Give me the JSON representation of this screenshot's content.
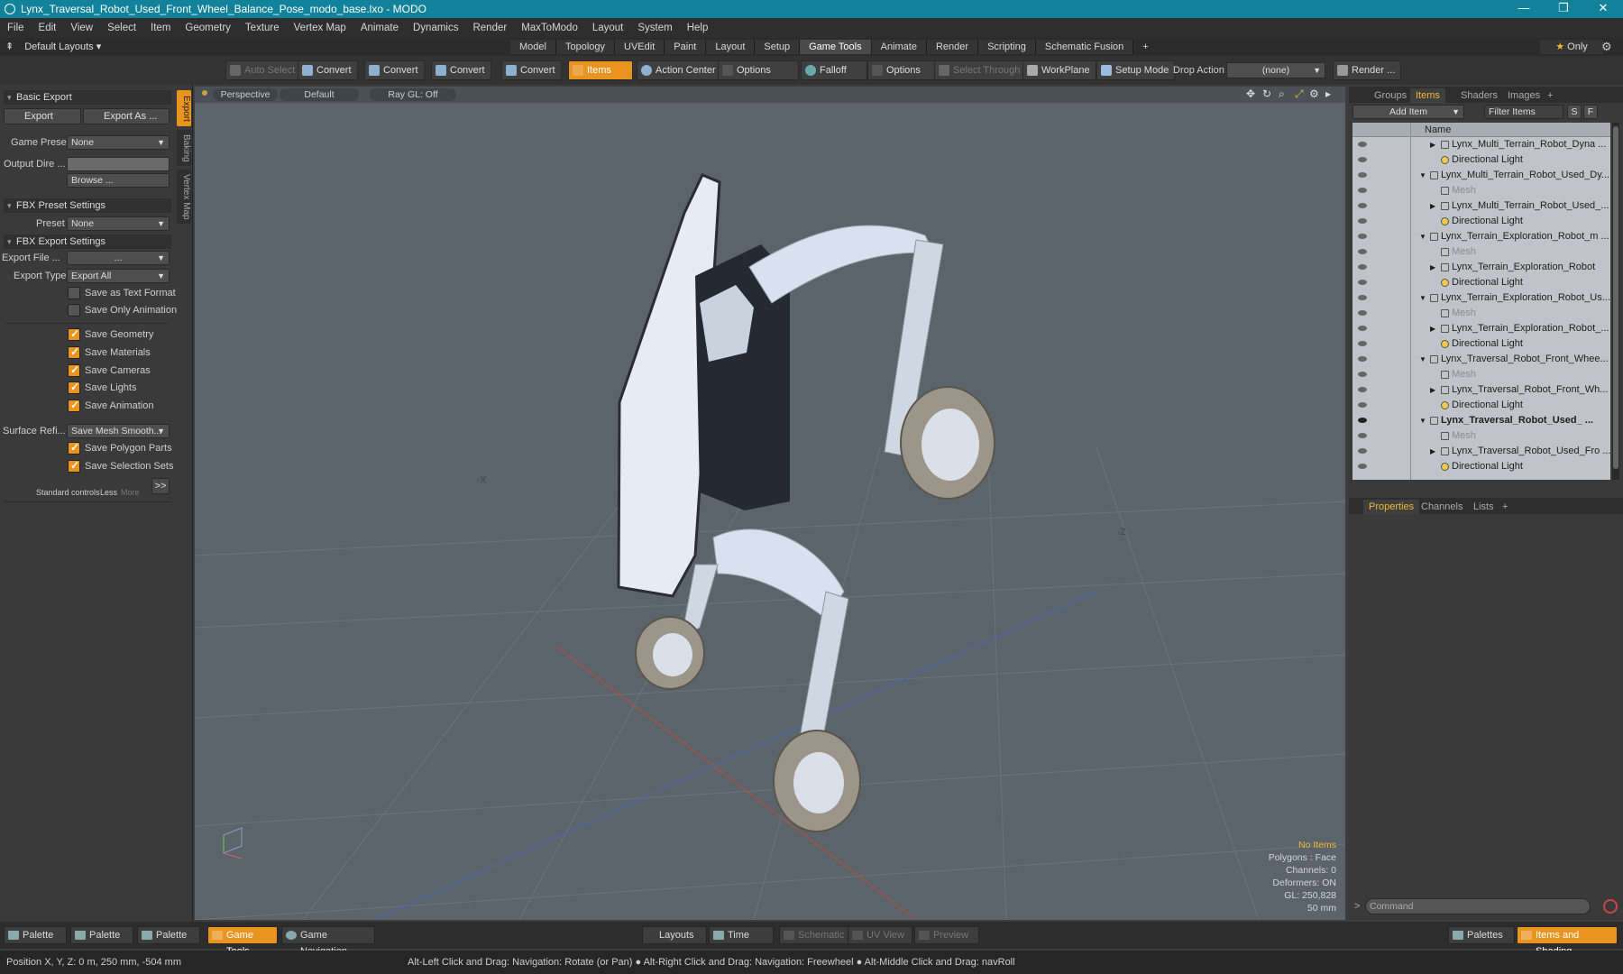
{
  "window": {
    "title": "Lynx_Traversal_Robot_Used_Front_Wheel_Balance_Pose_modo_base.lxo - MODO"
  },
  "menu": [
    "File",
    "Edit",
    "View",
    "Select",
    "Item",
    "Geometry",
    "Texture",
    "Vertex Map",
    "Animate",
    "Dynamics",
    "Render",
    "MaxToModo",
    "Layout",
    "System",
    "Help"
  ],
  "layouts": {
    "label": "Default Layouts ▾"
  },
  "tabs": [
    "Model",
    "Topology",
    "UVEdit",
    "Paint",
    "Layout",
    "Setup",
    "Game Tools",
    "Animate",
    "Render",
    "Scripting",
    "Schematic Fusion",
    "+"
  ],
  "only": {
    "star": "★",
    "label": "Only"
  },
  "toolbar": {
    "auto_select": "Auto Select",
    "convert": "Convert",
    "items": "Items",
    "action_center": "Action Center",
    "options": "Options",
    "falloff": "Falloff",
    "select_through": "Select Through",
    "workplane": "WorkPlane",
    "setup_mode": "Setup Mode",
    "drop_action": "Drop Action",
    "none": "(none)",
    "render": "Render ..."
  },
  "left": {
    "vtabs": [
      "Export",
      "Baking",
      "Vertex Map"
    ],
    "basic_export": "Basic Export",
    "export": "Export",
    "export_as": "Export As ...",
    "game_preset_label": "Game Preset",
    "game_preset": "None",
    "output_dir_label": "Output Dire ...",
    "browse": "Browse ...",
    "fbx_preset_settings": "FBX Preset Settings",
    "preset_label": "Preset",
    "preset": "None",
    "fbx_export_settings": "FBX Export Settings",
    "export_file_label": "Export File ...",
    "export_file": "...",
    "export_type_label": "Export Type",
    "export_type": "Export All",
    "checks": [
      {
        "label": "Save as Text Format",
        "on": false
      },
      {
        "label": "Save Only Animation",
        "on": false
      },
      {
        "label": "Save Geometry",
        "on": true
      },
      {
        "label": "Save Materials",
        "on": true
      },
      {
        "label": "Save Cameras",
        "on": true
      },
      {
        "label": "Save Lights",
        "on": true
      },
      {
        "label": "Save Animation",
        "on": true
      }
    ],
    "surface_label": "Surface Refi...",
    "surface": "Save Mesh Smooth...",
    "checks2": [
      {
        "label": "Save Polygon Parts",
        "on": true
      },
      {
        "label": "Save Selection Sets",
        "on": true
      }
    ],
    "std_controls": "Standard controls",
    "less": "Less",
    "more": "More",
    "expand": ">>"
  },
  "viewport": {
    "perspective": "Perspective",
    "default": "Default",
    "raygl": "Ray GL: Off",
    "stats": {
      "no_items": "No Items",
      "polygons": "Polygons : Face",
      "channels": "Channels: 0",
      "deformers": "Deformers: ON",
      "gl": "GL: 250,828",
      "mm": "50 mm"
    }
  },
  "right": {
    "tabs": [
      "Groups",
      "Items",
      "Shaders",
      "Images",
      "+"
    ],
    "add_item": "Add Item",
    "filter_items": "Filter Items",
    "s": "S",
    "f": "F",
    "name_col": "Name",
    "tree": [
      {
        "t": "Lynx_Multi_Terrain_Robot_Dyna ...",
        "lvl": 2,
        "kind": "mesh",
        "arrow": "▶"
      },
      {
        "t": "Directional Light",
        "lvl": 2,
        "kind": "light",
        "arrow": ""
      },
      {
        "t": "Lynx_Multi_Terrain_Robot_Used_Dy...",
        "lvl": 1,
        "kind": "group",
        "arrow": "▼"
      },
      {
        "t": "Mesh",
        "lvl": 2,
        "kind": "grey",
        "arrow": ""
      },
      {
        "t": "Lynx_Multi_Terrain_Robot_Used_...",
        "lvl": 2,
        "kind": "mesh",
        "arrow": "▶"
      },
      {
        "t": "Directional Light",
        "lvl": 2,
        "kind": "light",
        "arrow": ""
      },
      {
        "t": "Lynx_Terrain_Exploration_Robot_m ...",
        "lvl": 1,
        "kind": "group",
        "arrow": "▼"
      },
      {
        "t": "Mesh",
        "lvl": 2,
        "kind": "grey",
        "arrow": ""
      },
      {
        "t": "Lynx_Terrain_Exploration_Robot",
        "lvl": 2,
        "kind": "mesh",
        "arrow": "▶"
      },
      {
        "t": "Directional Light",
        "lvl": 2,
        "kind": "light",
        "arrow": ""
      },
      {
        "t": "Lynx_Terrain_Exploration_Robot_Us...",
        "lvl": 1,
        "kind": "group",
        "arrow": "▼"
      },
      {
        "t": "Mesh",
        "lvl": 2,
        "kind": "grey",
        "arrow": ""
      },
      {
        "t": "Lynx_Terrain_Exploration_Robot_...",
        "lvl": 2,
        "kind": "mesh",
        "arrow": "▶"
      },
      {
        "t": "Directional Light",
        "lvl": 2,
        "kind": "light",
        "arrow": ""
      },
      {
        "t": "Lynx_Traversal_Robot_Front_Whee...",
        "lvl": 1,
        "kind": "group",
        "arrow": "▼"
      },
      {
        "t": "Mesh",
        "lvl": 2,
        "kind": "grey",
        "arrow": ""
      },
      {
        "t": "Lynx_Traversal_Robot_Front_Wh...",
        "lvl": 2,
        "kind": "mesh",
        "arrow": "▶"
      },
      {
        "t": "Directional Light",
        "lvl": 2,
        "kind": "light",
        "arrow": ""
      },
      {
        "t": "Lynx_Traversal_Robot_Used_ ...",
        "lvl": 1,
        "kind": "bold",
        "arrow": "▼"
      },
      {
        "t": "Mesh",
        "lvl": 2,
        "kind": "grey",
        "arrow": ""
      },
      {
        "t": "Lynx_Traversal_Robot_Used_Fro ...",
        "lvl": 2,
        "kind": "mesh",
        "arrow": "▶"
      },
      {
        "t": "Directional Light",
        "lvl": 2,
        "kind": "light",
        "arrow": ""
      }
    ],
    "ptabs": [
      "Properties",
      "Channels",
      "Lists",
      "+"
    ],
    "command": "Command"
  },
  "bottom": {
    "palette": "Palette",
    "game_tools": "Game Tools",
    "game_navigation": "Game Navigation",
    "layouts": "Layouts",
    "time": "Time",
    "schematic": "Schematic",
    "uv_view": "UV View",
    "preview": "Preview",
    "palettes": "Palettes",
    "items_shading": "Items and Shading"
  },
  "status": {
    "position": "Position X, Y, Z:  0 m, 250 mm, -504 mm",
    "hint": "Alt-Left Click and Drag: Navigation: Rotate (or Pan) ● Alt-Right Click and Drag: Navigation: Freewheel ● Alt-Middle Click and Drag: navRoll"
  },
  "colors": {
    "accent": "#e8941f",
    "titlebar": "#11829a",
    "viewport": "#5b646b"
  }
}
